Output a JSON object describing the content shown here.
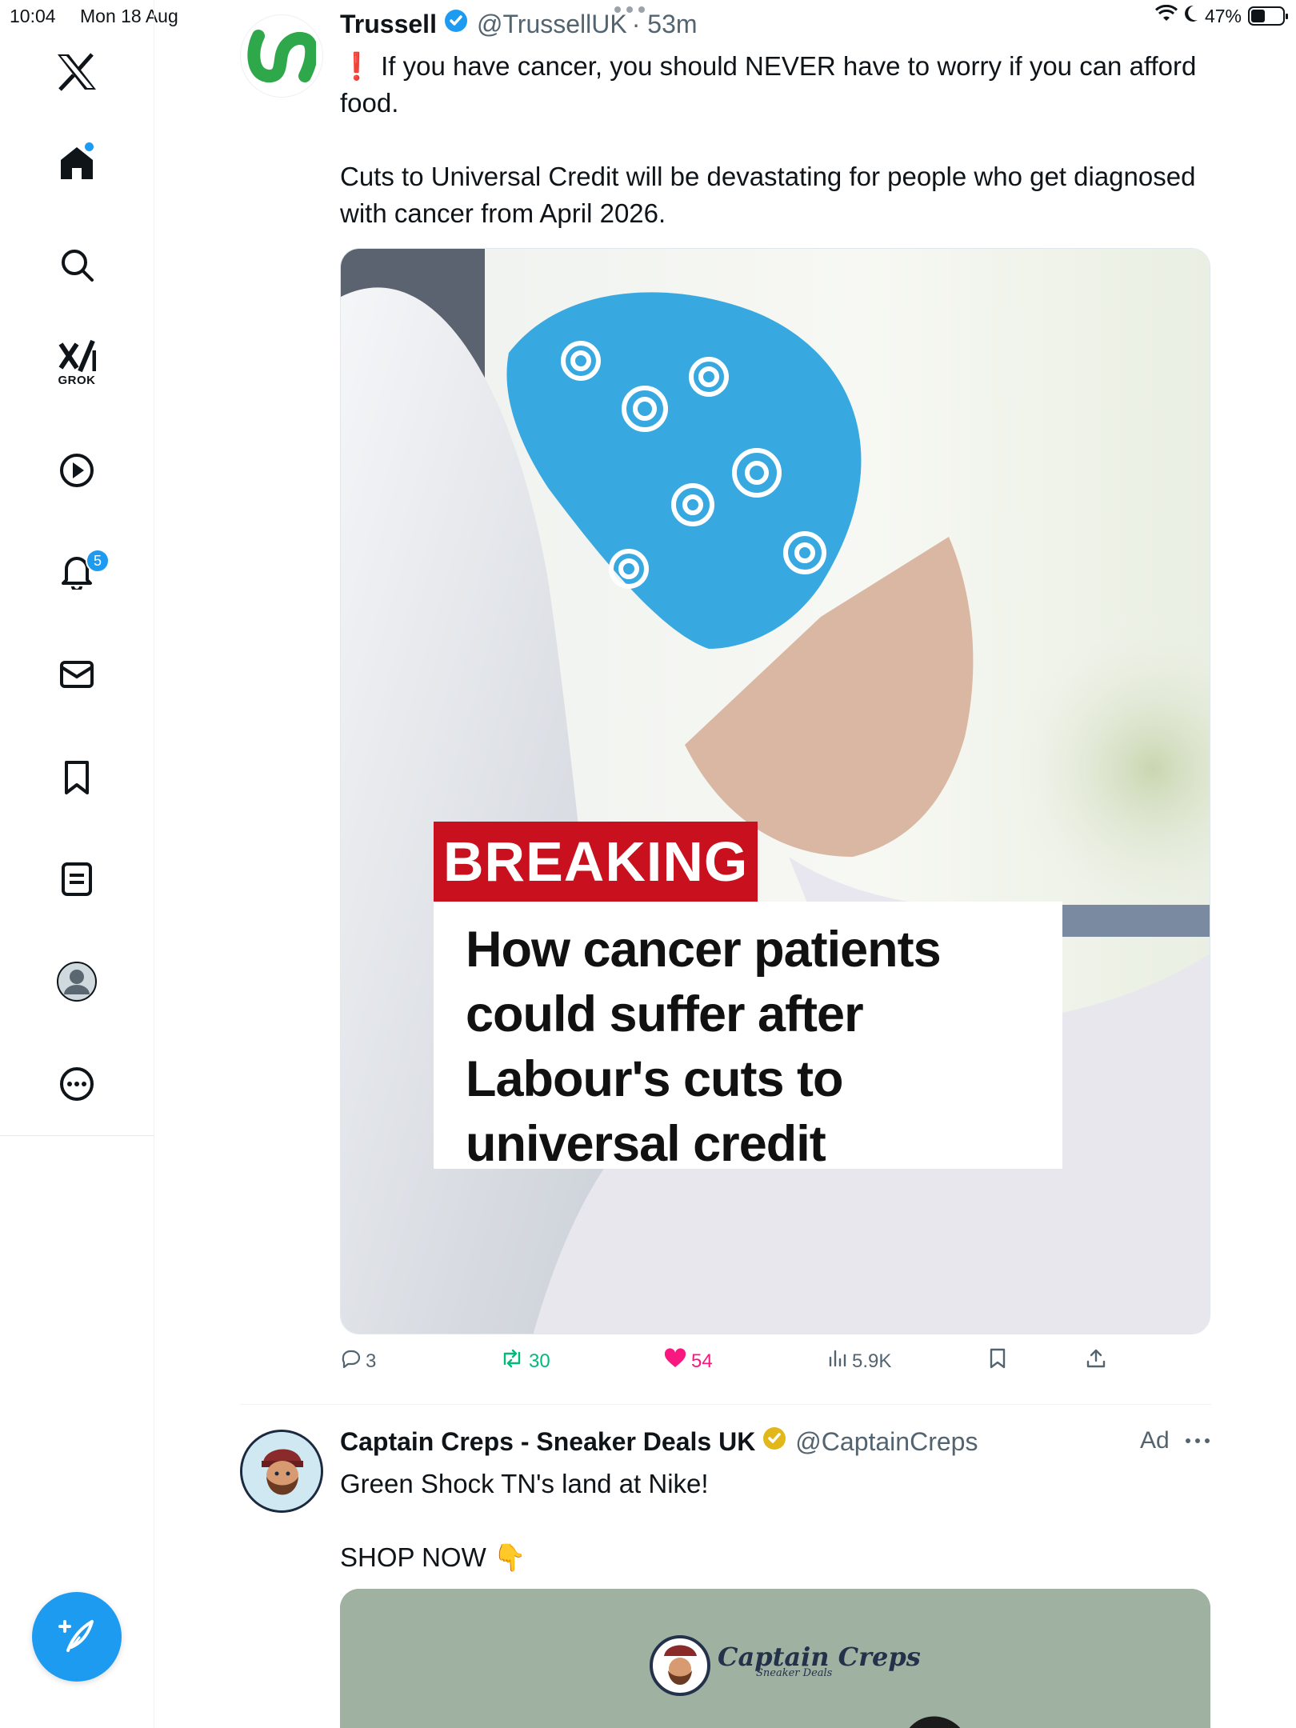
{
  "status_bar": {
    "time": "10:04",
    "date": "Mon 18 Aug",
    "battery": "47%",
    "battery_level": 0.47
  },
  "sidebar": {
    "items": [
      {
        "name": "home",
        "icon": "home-icon",
        "notification_dot": true
      },
      {
        "name": "explore",
        "icon": "search-icon"
      },
      {
        "name": "grok",
        "icon": "grok-icon",
        "label": "GROK"
      },
      {
        "name": "video",
        "icon": "play-icon"
      },
      {
        "name": "notifications",
        "icon": "bell-icon",
        "badge": "5"
      },
      {
        "name": "messages",
        "icon": "envelope-icon"
      },
      {
        "name": "bookmarks",
        "icon": "bookmark-icon"
      },
      {
        "name": "lists",
        "icon": "list-icon"
      },
      {
        "name": "profile",
        "icon": "profile-icon"
      },
      {
        "name": "more",
        "icon": "more-icon"
      }
    ],
    "compose_icon": "compose-icon"
  },
  "tweet": {
    "name": "Trussell",
    "handle": "@TrussellUK",
    "time": "· 53m",
    "verified_color": "#1d9bf0",
    "text_lines": [
      "If you have cancer, you should NEVER have to worry if you can afford food.",
      "Cuts to Universal Credit will be devastating for people who get diagnosed with cancer from April 2026."
    ],
    "emoji": "❗",
    "media": {
      "breaking_label": "BREAKING",
      "headline_lines": [
        "How cancer patients",
        "could suffer after",
        "Labour's cuts to",
        "universal credit"
      ]
    },
    "actions": {
      "replies": "3",
      "reposts": "30",
      "likes": "54",
      "views": "5.9K"
    },
    "like_color": "#f91880",
    "repost_color": "#00ba7c"
  },
  "ad": {
    "name": "Captain Creps - Sneaker Deals UK",
    "handle": "@CaptainCreps",
    "verified_color": "#e2b719",
    "ad_label": "Ad",
    "text": "Green Shock TN's land at Nike!",
    "cta": "SHOP NOW",
    "cta_emoji": "👇",
    "media_logo": "Captain Creps",
    "media_logo_sub": "Sneaker Deals"
  }
}
